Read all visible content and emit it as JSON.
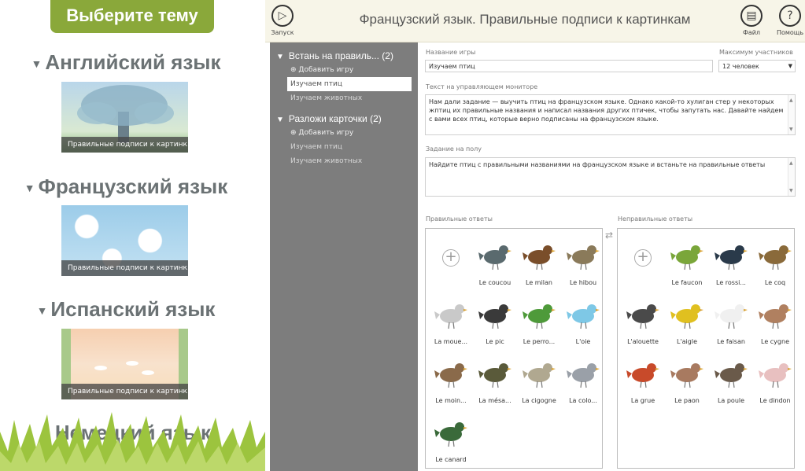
{
  "left_panel": {
    "choose_label": "Выберите тему",
    "topics": [
      {
        "name": "Английский язык",
        "caption": "Правильные подписи к картинк..."
      },
      {
        "name": "Французский язык",
        "caption": "Правильные подписи к картинк..."
      },
      {
        "name": "Испанский язык",
        "caption": "Правильные подписи к картинк..."
      },
      {
        "name": "Немецкий язык"
      }
    ]
  },
  "toolbar": {
    "title": "Французский язык. Правильные подписи к картинкам",
    "run_label": "Запуск",
    "file_label": "Файл",
    "help_label": "Помощь"
  },
  "games": {
    "sections": [
      {
        "title": "Встань на правиль... (2)",
        "add_label": "Добавить игру",
        "items": [
          "Изучаем птиц",
          "Изучаем животных"
        ],
        "selected": 0
      },
      {
        "title": "Разложи карточки (2)",
        "add_label": "Добавить игру",
        "items": [
          "Изучаем птиц",
          "Изучаем животных"
        ]
      }
    ]
  },
  "editor": {
    "game_name_label": "Название игры",
    "game_name_value": "Изучаем птиц",
    "max_players_label": "Максимум участников",
    "max_players_value": "12 человек",
    "monitor_text_label": "Текст на управляющем мониторе",
    "monitor_text_value": "Нам дали задание — выучить птиц на французском языке. Однако какой-то хулиган стер у некоторых жптиц их правильные названия и написал названия других птичек, чтобы запутать нас. Давайте найдем с вами всех птиц, которые верно подписаны на французском языке.",
    "floor_task_label": "Задание на полу",
    "floor_task_value": "Найдите птиц с правильными названиями на французском языке и встаньте на правильные ответы",
    "correct_label": "Правильные ответы",
    "wrong_label": "Неправильные ответы",
    "correct_answers": [
      "Le coucou",
      "Le milan",
      "Le hibou",
      "La moue...",
      "Le pic",
      "Le perro...",
      "L'oie",
      "Le moin...",
      "La mésa...",
      "La cigogne",
      "La colo...",
      "Le canard"
    ],
    "wrong_answers": [
      "Le faucon",
      "Le rossi...",
      "Le coq",
      "L'alouette",
      "L'aigle",
      "Le faisan",
      "Le cygne",
      "La grue",
      "Le paon",
      "La poule",
      "Le dindon"
    ]
  },
  "colors": {
    "accent_green": "#8aa83a",
    "topbar_bg": "#f7f5e8",
    "games_panel_bg": "#7d7d7d"
  }
}
